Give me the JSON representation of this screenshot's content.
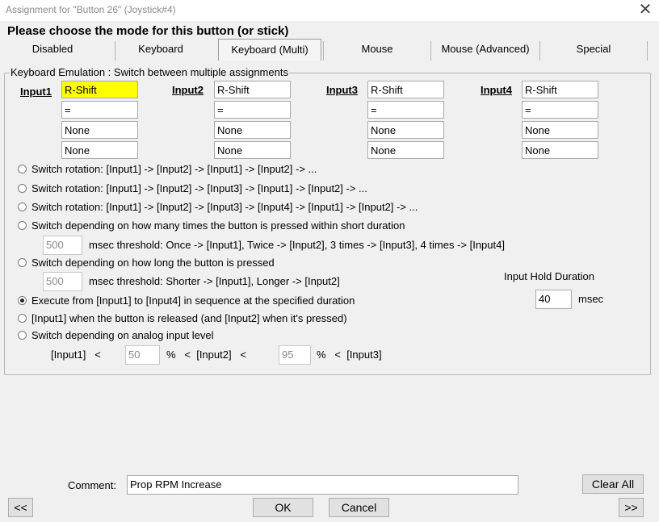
{
  "window": {
    "title": "Assignment for \"Button 26\" (Joystick#4)",
    "heading": "Please choose the mode for this button (or stick)"
  },
  "tabs": [
    "Disabled",
    "Keyboard",
    "Keyboard (Multi)",
    "Mouse",
    "Mouse (Advanced)",
    "Special"
  ],
  "active_tab": "Keyboard (Multi)",
  "group": {
    "title": "Keyboard Emulation : Switch between multiple assignments"
  },
  "inputs": [
    {
      "label": "Input1",
      "values": [
        "R-Shift",
        "=",
        "None",
        "None"
      ]
    },
    {
      "label": "Input2",
      "values": [
        "R-Shift",
        "=",
        "None",
        "None"
      ]
    },
    {
      "label": "Input3",
      "values": [
        "R-Shift",
        "=",
        "None",
        "None"
      ]
    },
    {
      "label": "Input4",
      "values": [
        "R-Shift",
        "=",
        "None",
        "None"
      ]
    }
  ],
  "options": [
    "Switch rotation: [Input1] -> [Input2] -> [Input1] -> [Input2] -> ...",
    "Switch rotation: [Input1] -> [Input2] -> [Input3] -> [Input1] -> [Input2] -> ...",
    "Switch rotation: [Input1] -> [Input2] -> [Input3] -> [Input4] -> [Input1] -> [Input2] -> ...",
    "Switch depending on how many times the button is pressed within short duration",
    "Switch depending on how long the button is pressed",
    "Execute from [Input1] to [Input4] in sequence at the specified duration",
    "[Input1] when the button is released (and [Input2] when it's pressed)",
    "Switch depending on analog input level"
  ],
  "selected_option": "Execute from [Input1] to [Input4] in sequence at the specified duration",
  "press_count": {
    "value": "500",
    "text": "msec threshold: Once -> [Input1], Twice -> [Input2], 3 times -> [Input3], 4 times -> [Input4]"
  },
  "press_length": {
    "value": "500",
    "text": "msec threshold: Shorter -> [Input1], Longer -> [Input2]"
  },
  "hold_duration": {
    "label": "Input Hold Duration",
    "value": "40",
    "unit": "msec"
  },
  "analog": {
    "prefix": "[Input1]   <",
    "low": "50",
    "middle": "%   <  [Input2]   <",
    "high": "95",
    "suffix": "%   <  [Input3]"
  },
  "comment": {
    "label": "Comment:",
    "value": "Prop RPM Increase"
  },
  "buttons": {
    "clear_all": "Clear All",
    "prev": "<<",
    "ok": "OK",
    "cancel": "Cancel",
    "next": ">>"
  }
}
